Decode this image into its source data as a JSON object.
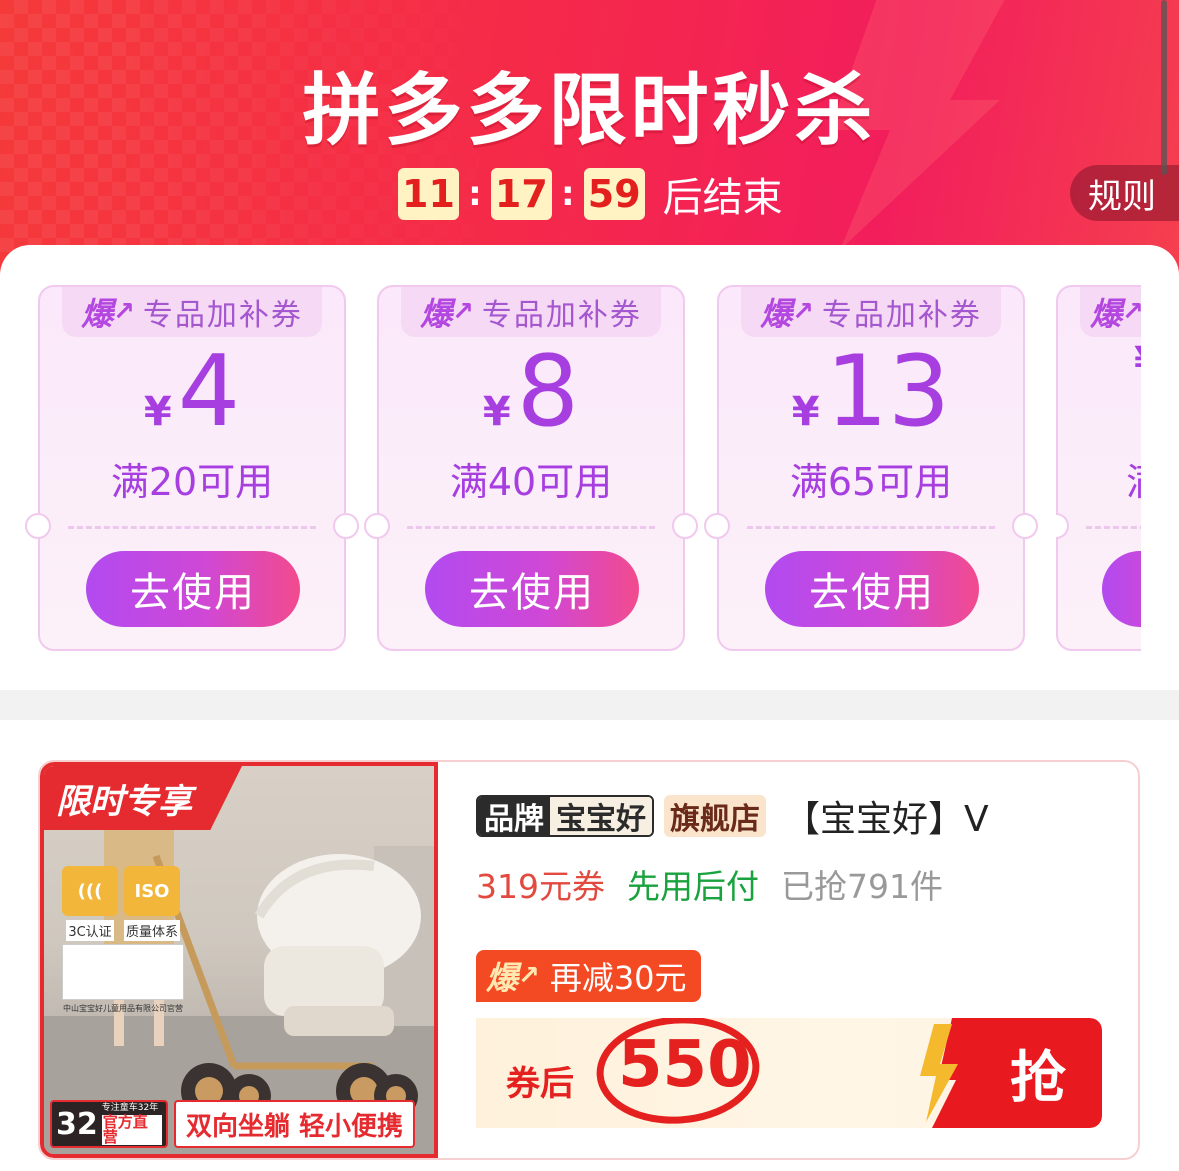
{
  "header": {
    "title": "拼多多限时秒杀",
    "timer": {
      "hours": "11",
      "minutes": "17",
      "seconds": "59",
      "sep": ":",
      "suffix": "后结束"
    },
    "rules_label": "规则"
  },
  "coupons": [
    {
      "badge": "爆",
      "badge_arrow": "↗",
      "tag": "专品加补券",
      "currency": "¥",
      "amount": "4",
      "condition": "满20可用",
      "button": "去使用"
    },
    {
      "badge": "爆",
      "badge_arrow": "↗",
      "tag": "专品加补券",
      "currency": "¥",
      "amount": "8",
      "condition": "满40可用",
      "button": "去使用"
    },
    {
      "badge": "爆",
      "badge_arrow": "↗",
      "tag": "专品加补券",
      "currency": "¥",
      "amount": "13",
      "condition": "满65可用",
      "button": "去使用"
    },
    {
      "badge": "爆",
      "badge_arrow": "↗",
      "currency": "¥",
      "condition": "满"
    }
  ],
  "product": {
    "image": {
      "ribbon": "限时专享",
      "certs": [
        {
          "badge": "(((",
          "label": "3C认证"
        },
        {
          "badge": "ISO",
          "label": "质量体系"
        }
      ],
      "company": "中山宝宝好儿童用品有限公司官营",
      "years": "32",
      "years_caption": "专注童车32年",
      "official": "官方直营",
      "slogan": "双向坐躺 轻小便携"
    },
    "brand_key": "品牌",
    "brand_value": "宝宝好",
    "store_tag": "旗舰店",
    "title": "【宝宝好】V",
    "coupon_text": "319元券",
    "pay_later": "先用后付",
    "sold": "已抢791件",
    "extra_badge": "爆",
    "extra_arrow": "↗",
    "extra_text": "再减30元",
    "price_prefix": "券后",
    "price": "550",
    "grab_button": "抢"
  },
  "colors": {
    "header_red": "#f5294a",
    "coupon_purple": "#a73fe0",
    "price_red": "#e4211e",
    "pay_later_green": "#19a23d",
    "timer_bg": "#fff3c4"
  }
}
